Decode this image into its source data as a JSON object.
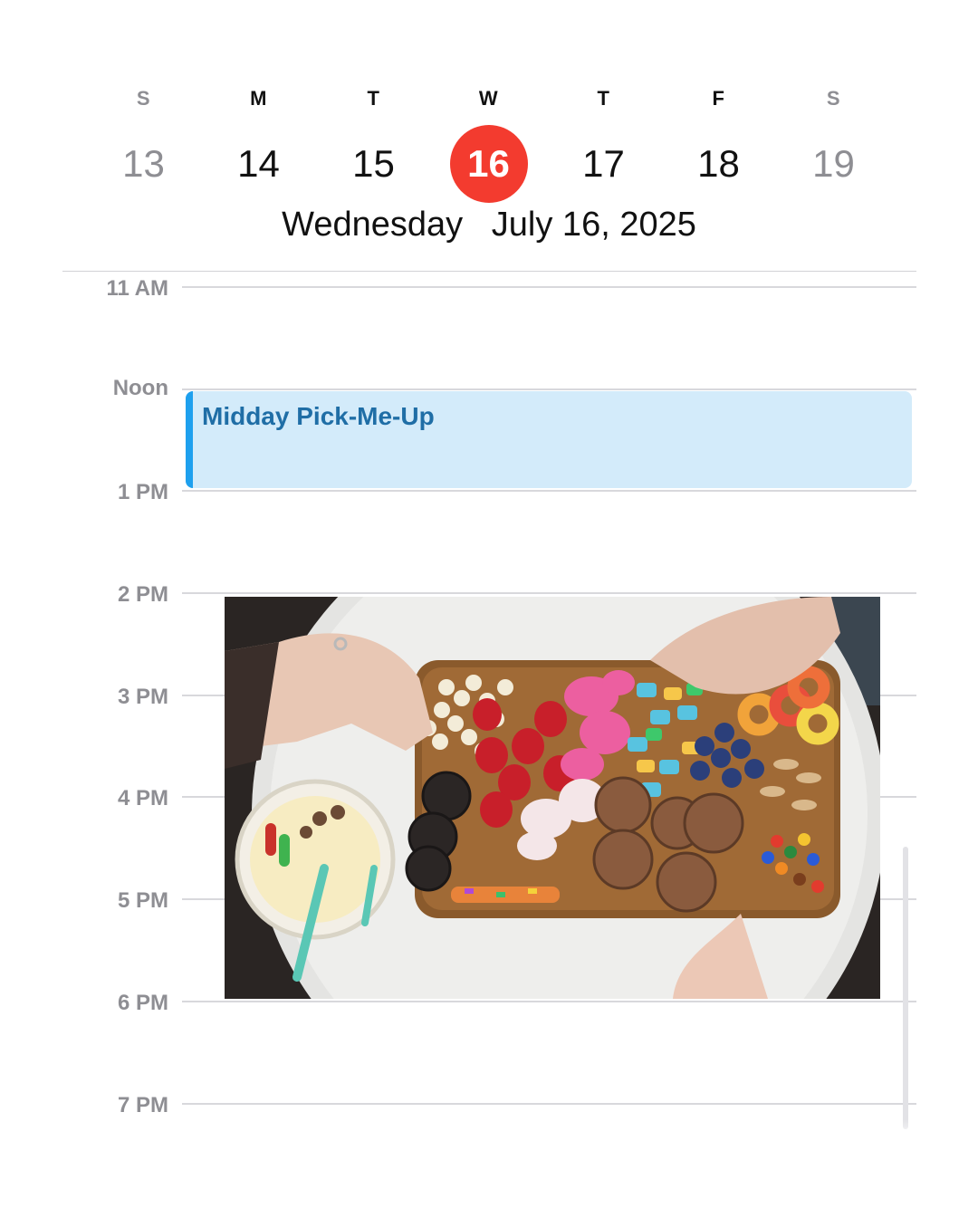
{
  "week": {
    "days": [
      {
        "letter": "S",
        "number": "13"
      },
      {
        "letter": "M",
        "number": "14"
      },
      {
        "letter": "T",
        "number": "15"
      },
      {
        "letter": "W",
        "number": "16"
      },
      {
        "letter": "T",
        "number": "17"
      },
      {
        "letter": "F",
        "number": "18"
      },
      {
        "letter": "S",
        "number": "19"
      }
    ],
    "selected_number": "16"
  },
  "header": {
    "date_title": "Wednesday   July 16, 2025"
  },
  "timeline": {
    "hours": [
      "11 AM",
      "Noon",
      "1 PM",
      "2 PM",
      "3 PM",
      "4 PM",
      "5 PM",
      "6 PM",
      "7 PM"
    ]
  },
  "event": {
    "title": "Midday Pick-Me-Up",
    "color": "#1ea0ee"
  },
  "colors": {
    "today_circle": "#f33b2f",
    "event_background": "#d3ebfa"
  }
}
